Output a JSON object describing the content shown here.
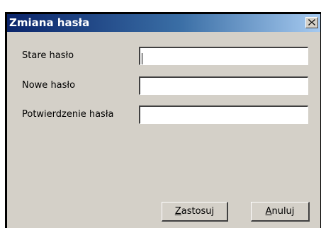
{
  "window": {
    "title": "Zmiana hasła",
    "close_glyph": "close-icon"
  },
  "fields": [
    {
      "label": "Stare hasło",
      "value": ""
    },
    {
      "label": "Nowe hasło",
      "value": ""
    },
    {
      "label": "Potwierdzenie hasła",
      "value": ""
    }
  ],
  "buttons": {
    "apply": {
      "accel": "Z",
      "rest": "astosuj"
    },
    "cancel": {
      "accel": "A",
      "rest": "nuluj"
    }
  }
}
